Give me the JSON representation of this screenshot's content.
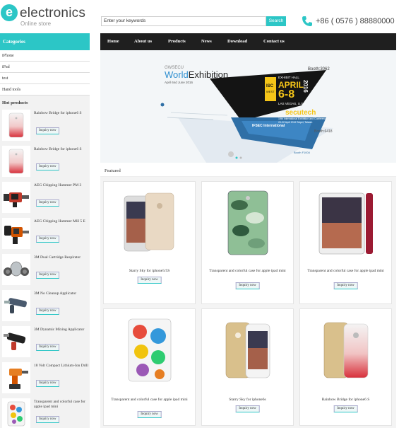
{
  "header": {
    "logo_letter": "e",
    "logo_title": "electronics",
    "logo_subtitle": "Online store",
    "search_value": "Enter your keywords",
    "search_button": "Search",
    "phone": "+86 ( 0576 ) 88880000"
  },
  "nav": [
    "Home",
    "About us",
    "Products",
    "News",
    "Download",
    "Contact us"
  ],
  "sidebar": {
    "categories_title": "Categories",
    "categories": [
      "iPhone",
      "iPad",
      "test",
      "Hand tools"
    ],
    "hot_title": "Hot products",
    "hot_products": [
      {
        "name": "Rainbow Bridge for iphone6 S",
        "button": "Inquiry now",
        "icon": "phone-case-gradient"
      },
      {
        "name": "Rainbow Bridge for iphone6 S",
        "button": "Inquiry now",
        "icon": "phone-case-gradient"
      },
      {
        "name": "AEG Chipping Hammer PM 3",
        "button": "Inquiry now",
        "icon": "chipping-hammer"
      },
      {
        "name": "AEG Chipping Hammer MH 5 E",
        "button": "Inquiry now",
        "icon": "chipping-hammer"
      },
      {
        "name": "3M Dual Cartridge Respirator",
        "button": "Inquiry now",
        "icon": "respirator"
      },
      {
        "name": "3M No Cleanup Applicator",
        "button": "Inquiry now",
        "icon": "applicator"
      },
      {
        "name": "3M Dynamic Mixing Applicator",
        "button": "Inquiry now",
        "icon": "mixing-applicator"
      },
      {
        "name": "18 Volt Compact Lithium-Ion Drill",
        "button": "Inquiry now",
        "icon": "drill"
      },
      {
        "name": "Transparent and colorful case for apple ipad mini",
        "button": "Inquiry now",
        "icon": "ipad-case"
      }
    ]
  },
  "banner": {
    "brand_top": "GWSECU",
    "title_part1": "World",
    "title_part2": "Exhibition",
    "date_line": "April 6nd June 2016",
    "booth_top": "Booth:3062",
    "isc": "ISC",
    "isc_sub": "WEST",
    "exhibit_hall": "EXHIBIT HALL",
    "month": "APRIL",
    "days": "6-8",
    "year": "2016",
    "city": "LAS VEGAS, U.S.A.",
    "secutech": "secutech",
    "secutech_sub": "19th International Exhibition and Conference",
    "secutech_date": "20-22 April 2016 Taipei, Taiwan",
    "booth_mid": "Booth:6418",
    "ifsec": "IFSEC International",
    "booth_bottom": "Booth F1004"
  },
  "featured": {
    "title": "Featured",
    "products": [
      {
        "name": "Starry Sky for iphone5/5S",
        "button": "Inquiry now",
        "icon": "starry-case"
      },
      {
        "name": "Transparent and colorful case for apple ipad mini",
        "button": "Inquiry now",
        "icon": "camo-case"
      },
      {
        "name": "Transparent and colorful case for apple ipad mini",
        "button": "Inquiry now",
        "icon": "red-ipad-case"
      },
      {
        "name": "Transparent and colorful case for apple ipad mini",
        "button": "Inquiry now",
        "icon": "colorful-ipad-case"
      },
      {
        "name": "Starry Sky for iphone6s",
        "button": "Inquiry now",
        "icon": "gold-phone-case"
      },
      {
        "name": "Rainbow Bridge for iphone6 S",
        "button": "Inquiry now",
        "icon": "rainbow-phone-case"
      }
    ]
  },
  "colors": {
    "accent": "#2cc6c6",
    "nav_bg": "#1f1f1f"
  }
}
